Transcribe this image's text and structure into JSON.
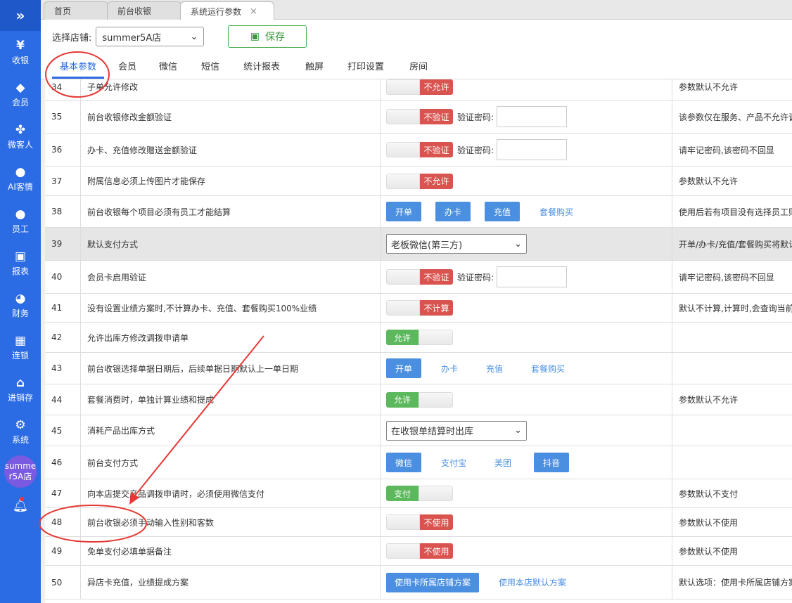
{
  "sidebar": {
    "items": [
      {
        "label": "收银",
        "icon": "cashier-icon"
      },
      {
        "label": "会员",
        "icon": "diamond-icon"
      },
      {
        "label": "微客人",
        "icon": "clover-icon"
      },
      {
        "label": "AI客情",
        "icon": "ai-person-icon"
      },
      {
        "label": "员工",
        "icon": "person-icon"
      },
      {
        "label": "报表",
        "icon": "monitor-icon"
      },
      {
        "label": "财务",
        "icon": "pie-icon"
      },
      {
        "label": "连锁",
        "icon": "building-icon"
      },
      {
        "label": "进销存",
        "icon": "house-icon"
      },
      {
        "label": "系统",
        "icon": "gear-icon"
      }
    ],
    "store_badge": "summer5A店"
  },
  "tabs": [
    {
      "label": "首页"
    },
    {
      "label": "前台收银"
    },
    {
      "label": "系统运行参数"
    }
  ],
  "toolbar": {
    "store_label": "选择店铺:",
    "store_value": "summer5A店",
    "save_label": "保存"
  },
  "subtabs": [
    "基本参数",
    "会员",
    "微信",
    "短信",
    "统计报表",
    "触屏",
    "打印设置",
    "房间"
  ],
  "rows": [
    {
      "no": "34",
      "name": "子单允许修改",
      "note": "参数默认不允许",
      "toggle": "不允许"
    },
    {
      "no": "35",
      "name": "前台收银修改金额验证",
      "note": "该参数仅在服务、产品不允许调",
      "toggle": "不验证",
      "pwd": "验证密码:"
    },
    {
      "no": "36",
      "name": "办卡、充值修改赠送金额验证",
      "note": "请牢记密码,该密码不回显",
      "toggle": "不验证",
      "pwd": "验证密码:"
    },
    {
      "no": "37",
      "name": "附属信息必须上传图片才能保存",
      "note": "参数默认不允许",
      "toggle": "不允许"
    },
    {
      "no": "38",
      "name": "前台收银每个项目必须有员工才能结算",
      "note": "使用后若有项目没有选择员工则",
      "buttons": [
        "开单",
        "办卡",
        "充值"
      ],
      "link": "套餐购买"
    },
    {
      "no": "39",
      "name": "默认支付方式",
      "note": "开单/办卡/充值/套餐购买将默认",
      "select": "老板微信(第三方)"
    },
    {
      "no": "40",
      "name": "会员卡启用验证",
      "note": "请牢记密码,该密码不回显",
      "toggle": "不验证",
      "pwd": "验证密码:"
    },
    {
      "no": "41",
      "name": "没有设置业绩方案时,不计算办卡、充值、套餐购买100%业绩",
      "note": "默认不计算,计算时,会查询当前",
      "toggle": "不计算"
    },
    {
      "no": "42",
      "name": "允许出库方修改调拨申请单",
      "note": "",
      "toggle_green": "允许"
    },
    {
      "no": "43",
      "name": "前台收银选择单据日期后，后续单据日期默认上一单日期",
      "note": "",
      "buttons": [
        "开单"
      ],
      "links": [
        "办卡",
        "充值",
        "套餐购买"
      ]
    },
    {
      "no": "44",
      "name": "套餐消费时，单独计算业绩和提成",
      "note": "参数默认不允许",
      "toggle_green": "允许"
    },
    {
      "no": "45",
      "name": "消耗产品出库方式",
      "note": "",
      "select": "在收银单结算时出库"
    },
    {
      "no": "46",
      "name": "前台支付方式",
      "note": "",
      "pay": [
        "微信",
        "支付宝",
        "美团",
        "抖音"
      ]
    },
    {
      "no": "47",
      "name": "向本店提交产品调拨申请时，必须使用微信支付",
      "note": "参数默认不支付",
      "toggle_green": "支付"
    },
    {
      "no": "48",
      "name": "前台收银必须手动输入性别和客数",
      "note": "参数默认不使用",
      "toggle": "不使用"
    },
    {
      "no": "49",
      "name": "免单支付必填单据备注",
      "note": "参数默认不使用",
      "toggle": "不使用"
    },
    {
      "no": "50",
      "name": "异店卡充值，业绩提成方案",
      "note": "默认选项：使用卡所属店铺方案",
      "buttons": [
        "使用卡所属店铺方案"
      ],
      "link": "使用本店默认方案"
    }
  ],
  "colors": {
    "sidebar": "#2b6be3",
    "accent_red": "#d9534f",
    "accent_green": "#5cb85c",
    "button_blue": "#4a8fe0",
    "annotation": "#e53935"
  }
}
